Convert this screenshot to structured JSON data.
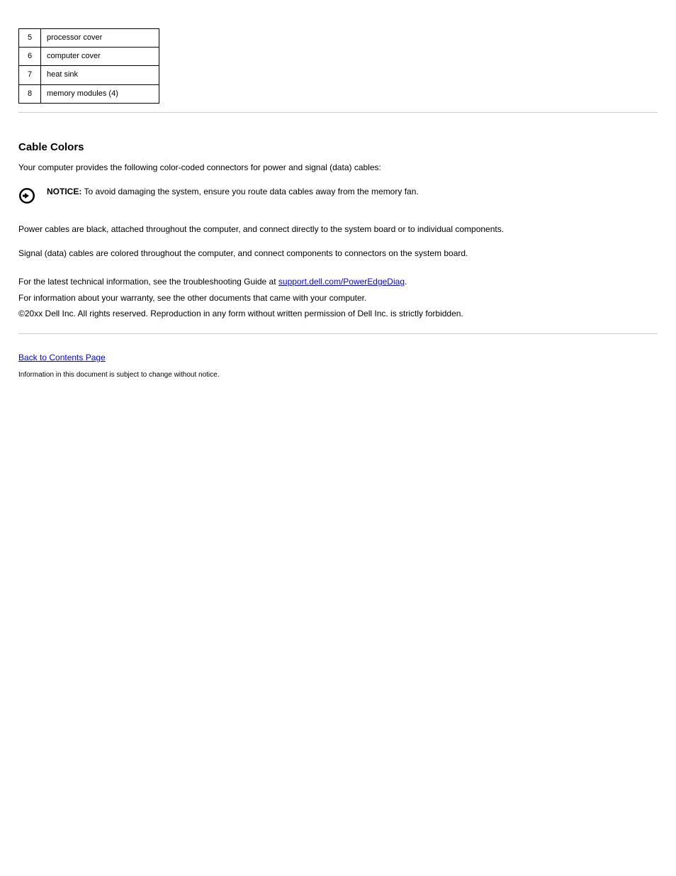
{
  "table": {
    "rows": [
      {
        "code": "5",
        "label": "processor cover"
      },
      {
        "code": "6",
        "label": "computer cover"
      },
      {
        "code": "7",
        "label": "heat sink"
      },
      {
        "code": "8",
        "label": "memory modules (4)"
      }
    ]
  },
  "section": {
    "heading": "Cable Colors",
    "intro": "Your computer provides the following color-coded connectors for power and signal (data) cables:",
    "notice_label": "NOTICE:",
    "notice_text": " To avoid damaging the system, ensure you route data cables away from the memory fan.",
    "bullets": [
      "Power cables are black, attached throughout the computer, and connect directly to the system board or to individual components.",
      "Signal (data) cables are colored throughout the computer, and connect components to connectors on the system board."
    ]
  },
  "support": {
    "line1_pre": "For the latest technical information, see the troubleshooting Guide at ",
    "line1_link": "support.dell.com/PowerEdgeDiag",
    "line2": "For information about your warranty, see the other documents that came with your computer.",
    "line3": "©20xx Dell Inc. All rights reserved. Reproduction in any form without written permission of Dell Inc. is strictly forbidden."
  },
  "footer": {
    "back_link": "Back to Contents Page",
    "copyright": "Information in this document is subject to change without notice."
  }
}
